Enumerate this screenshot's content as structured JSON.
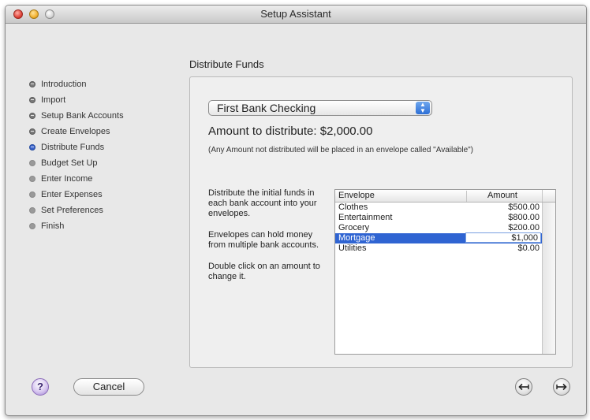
{
  "window": {
    "title": "Setup Assistant"
  },
  "section_title": "Distribute Funds",
  "steps": [
    {
      "label": "Introduction",
      "state": "done"
    },
    {
      "label": "Import",
      "state": "done"
    },
    {
      "label": "Setup Bank Accounts",
      "state": "done"
    },
    {
      "label": "Create Envelopes",
      "state": "done"
    },
    {
      "label": "Distribute Funds",
      "state": "current"
    },
    {
      "label": "Budget Set Up",
      "state": "todo"
    },
    {
      "label": "Enter Income",
      "state": "todo"
    },
    {
      "label": "Enter Expenses",
      "state": "todo"
    },
    {
      "label": "Set Preferences",
      "state": "todo"
    },
    {
      "label": "Finish",
      "state": "todo"
    }
  ],
  "account_popup": {
    "selected": "First Bank Checking"
  },
  "amount": {
    "label": "Amount to distribute:",
    "value": "$2,000.00"
  },
  "note": "(Any Amount not distributed will be placed in an envelope called \"Available\")",
  "help_paragraphs": [
    "Distribute the initial funds in each bank account into your envelopes.",
    "Envelopes can hold money from multiple bank accounts.",
    "Double click on an amount to change it."
  ],
  "table": {
    "headers": {
      "envelope": "Envelope",
      "amount": "Amount"
    },
    "rows": [
      {
        "envelope": "Clothes",
        "amount": "$500.00"
      },
      {
        "envelope": "Entertainment",
        "amount": "$800.00"
      },
      {
        "envelope": "Grocery",
        "amount": "$200.00"
      },
      {
        "envelope": "Mortgage",
        "amount": "$1,000",
        "selected": true,
        "editing": true
      },
      {
        "envelope": "Utilities",
        "amount": "$0.00"
      }
    ]
  },
  "buttons": {
    "help": "?",
    "cancel": "Cancel",
    "back_icon": "back-arrow-icon",
    "forward_icon": "forward-arrow-icon"
  },
  "colors": {
    "selection": "#2f64d2",
    "current_step": "#3a62c9"
  }
}
